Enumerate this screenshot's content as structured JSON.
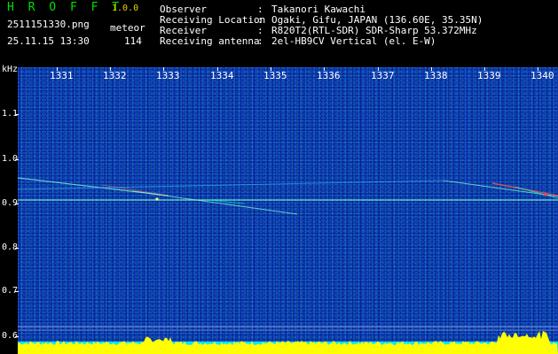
{
  "app": {
    "name": "H R O F F T",
    "version": "1.0.0"
  },
  "capture": {
    "filename": "2511151330.png",
    "datetime": "25.11.15 13:30",
    "type": "meteor",
    "count": "114"
  },
  "meta": [
    {
      "label": "Observer",
      "value": "Takanori Kawachi"
    },
    {
      "label": "Receiving Location",
      "value": "Ogaki, Gifu, JAPAN (136.60E, 35.35N)"
    },
    {
      "label": "Receiver",
      "value": "R820T2(RTL-SDR) SDR-Sharp 53.372MHz"
    },
    {
      "label": "Receiving antenna",
      "value": "2el-HB9CV Vertical (el. E-W)"
    }
  ],
  "y_unit": "kHz",
  "x_ticks": [
    "1331",
    "1332",
    "1333",
    "1334",
    "1335",
    "1336",
    "1337",
    "1338",
    "1339",
    "1340"
  ],
  "y_ticks": [
    "1.1",
    "1.0",
    "0.9",
    "0.8",
    "0.7",
    "0.6"
  ],
  "colors": {
    "background": "#0a2cb0",
    "title": "#00e000",
    "version": "#e6d200",
    "power_bar": "#00e8ff",
    "power_peak": "#ffff00",
    "echo": "#7fffd4"
  }
}
